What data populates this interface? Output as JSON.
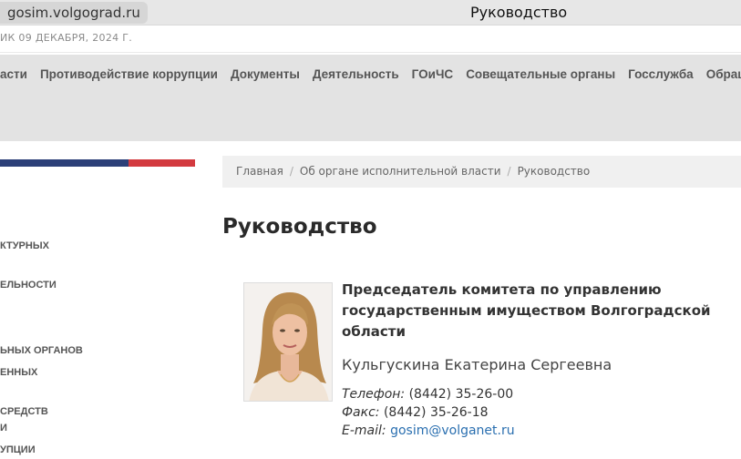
{
  "browser": {
    "url": "gosim.volgograd.ru",
    "tab_title": "Руководство"
  },
  "header": {
    "date_line": "ИК 09 ДЕКАБРЯ, 2024 Г."
  },
  "nav": {
    "items": [
      "асти",
      "Противодействие коррупции",
      "Документы",
      "Деятельность",
      "ГОиЧС",
      "Совещательные органы",
      "Госслужба",
      "Обращен"
    ]
  },
  "sidebar": {
    "items": [
      "КТУРНЫХ",
      "ЕЛЬНОСТИ",
      "ЬНЫХ ОРГАНОВ",
      "ЕННЫХ",
      " СРЕДСТВ",
      "И",
      "УПЦИИ"
    ]
  },
  "breadcrumb": {
    "home": "Главная",
    "section": "Об органе исполнительной власти",
    "current": "Руководство"
  },
  "page": {
    "title": "Руководство"
  },
  "person": {
    "position": "Председатель комитета по управлению государственным имуществом Волгоградской области",
    "name": "Кульгускина Екатерина Сергеевна",
    "phone_label": "Телефон:",
    "phone": "(8442) 35-26-00",
    "fax_label": "Факс:",
    "fax": "(8442) 35-26-18",
    "email_label": "E-mail:",
    "email": "gosim@volganet.ru"
  },
  "colors": {
    "stripe_blue": "#2c3f78",
    "stripe_red": "#d33a3f",
    "link": "#2a6fb0"
  }
}
